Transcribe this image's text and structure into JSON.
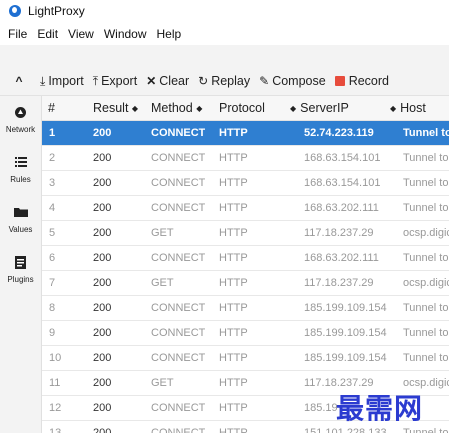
{
  "app": {
    "title": "LightProxy"
  },
  "menu": [
    "File",
    "Edit",
    "View",
    "Window",
    "Help"
  ],
  "toolbar": {
    "collapse_icon": "chevron-up-icon",
    "import": "Import",
    "export": "Export",
    "clear": "Clear",
    "replay": "Replay",
    "compose": "Compose",
    "record": "Record",
    "record_color": "#e74c3c"
  },
  "sidebar": [
    {
      "label": "Network",
      "icon": "network-icon"
    },
    {
      "label": "Rules",
      "icon": "list-icon"
    },
    {
      "label": "Values",
      "icon": "folder-icon"
    },
    {
      "label": "Plugins",
      "icon": "plugin-icon"
    }
  ],
  "table": {
    "columns": [
      "#",
      "Result",
      "Method",
      "Protocol",
      "ServerIP",
      "Host"
    ],
    "selected_color": "#2f7fd1",
    "rows": [
      {
        "num": "1",
        "result": "200",
        "method": "CONNECT",
        "protocol": "HTTP",
        "ip": "52.74.223.119",
        "host": "Tunnel to"
      },
      {
        "num": "2",
        "result": "200",
        "method": "CONNECT",
        "protocol": "HTTP",
        "ip": "168.63.154.101",
        "host": "Tunnel to"
      },
      {
        "num": "3",
        "result": "200",
        "method": "CONNECT",
        "protocol": "HTTP",
        "ip": "168.63.154.101",
        "host": "Tunnel to"
      },
      {
        "num": "4",
        "result": "200",
        "method": "CONNECT",
        "protocol": "HTTP",
        "ip": "168.63.202.111",
        "host": "Tunnel to"
      },
      {
        "num": "5",
        "result": "200",
        "method": "GET",
        "protocol": "HTTP",
        "ip": "117.18.237.29",
        "host": "ocsp.digic"
      },
      {
        "num": "6",
        "result": "200",
        "method": "CONNECT",
        "protocol": "HTTP",
        "ip": "168.63.202.111",
        "host": "Tunnel to"
      },
      {
        "num": "7",
        "result": "200",
        "method": "GET",
        "protocol": "HTTP",
        "ip": "117.18.237.29",
        "host": "ocsp.digic"
      },
      {
        "num": "8",
        "result": "200",
        "method": "CONNECT",
        "protocol": "HTTP",
        "ip": "185.199.109.154",
        "host": "Tunnel to"
      },
      {
        "num": "9",
        "result": "200",
        "method": "CONNECT",
        "protocol": "HTTP",
        "ip": "185.199.109.154",
        "host": "Tunnel to"
      },
      {
        "num": "10",
        "result": "200",
        "method": "CONNECT",
        "protocol": "HTTP",
        "ip": "185.199.109.154",
        "host": "Tunnel to"
      },
      {
        "num": "11",
        "result": "200",
        "method": "GET",
        "protocol": "HTTP",
        "ip": "117.18.237.29",
        "host": "ocsp.digic"
      },
      {
        "num": "12",
        "result": "200",
        "method": "CONNECT",
        "protocol": "HTTP",
        "ip": "185.19",
        "host": ""
      },
      {
        "num": "13",
        "result": "200",
        "method": "CONNECT",
        "protocol": "HTTP",
        "ip": "151.101.228.133",
        "host": "Tunnel to"
      }
    ]
  },
  "watermark": {
    "text": "最需网",
    "color": "#2b3bd0"
  }
}
